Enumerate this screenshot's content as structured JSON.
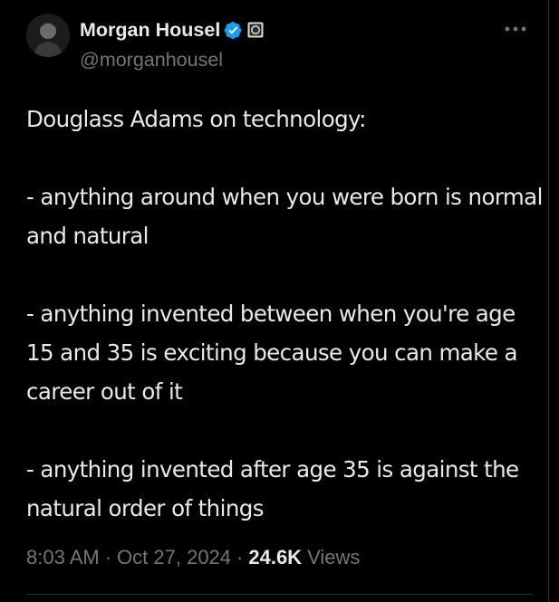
{
  "author": {
    "display_name": "Morgan Housel",
    "handle": "@morganhousel",
    "avatar": "avatar-photo",
    "verified_icon": "verified-badge-icon",
    "affiliate_icon": "affiliate-badge-icon"
  },
  "menu": {
    "more_icon": "more-horizontal-icon"
  },
  "tweet": {
    "line_1": "Douglass Adams on technology:",
    "paragraph_1": "- anything around when you were born is normal and natural",
    "paragraph_2": "- anything invented between when you're age 15 and 35 is exciting because you can make a career out of it",
    "paragraph_3": "- anything invented after age 35 is against the natural order of things"
  },
  "meta": {
    "time": "8:03 AM",
    "separator": "·",
    "date": "Oct 27, 2024",
    "views_count": "24.6K",
    "views_label": "Views"
  },
  "colors": {
    "background": "#000000",
    "text_primary": "#e7e9ea",
    "text_secondary": "#71767b",
    "verified_blue": "#1d9bf0",
    "divider": "#2f3336"
  }
}
